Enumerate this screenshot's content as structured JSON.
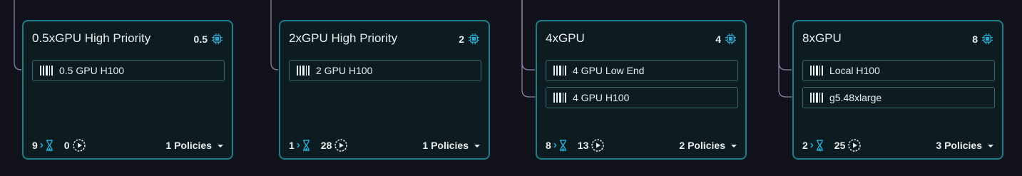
{
  "colors": {
    "background": "#11121c",
    "card_background": "#0d1c20",
    "card_border": "#1c7e86",
    "accent": "#27a9cf",
    "connector": "#8a87a6"
  },
  "cards": [
    {
      "title": "0.5xGPU High Priority",
      "gpu": "0.5",
      "resources": [
        {
          "label": "0.5 GPU H100",
          "icon": "resource-bars-icon"
        }
      ],
      "queued": "9",
      "running": "0",
      "policies": "1 Policies"
    },
    {
      "title": "2xGPU High Priority",
      "gpu": "2",
      "resources": [
        {
          "label": "2 GPU H100",
          "icon": "resource-bars-icon"
        }
      ],
      "queued": "1",
      "running": "28",
      "policies": "1 Policies"
    },
    {
      "title": "4xGPU",
      "gpu": "4",
      "resources": [
        {
          "label": "4 GPU Low End",
          "icon": "resource-bars-icon"
        },
        {
          "label": "4 GPU H100",
          "icon": "resource-bars-icon"
        }
      ],
      "queued": "8",
      "running": "13",
      "policies": "2 Policies"
    },
    {
      "title": "8xGPU",
      "gpu": "8",
      "resources": [
        {
          "label": "Local H100",
          "icon": "resource-bars-icon"
        },
        {
          "label": "g5.48xlarge",
          "icon": "resource-bars-icon"
        }
      ],
      "queued": "2",
      "running": "25",
      "policies": "3 Policies"
    }
  ],
  "icons": {
    "gpu": "gpu-chip-icon",
    "queued": "hourglass-icon",
    "running": "play-circle-icon",
    "policies": "chevron-down-icon"
  }
}
